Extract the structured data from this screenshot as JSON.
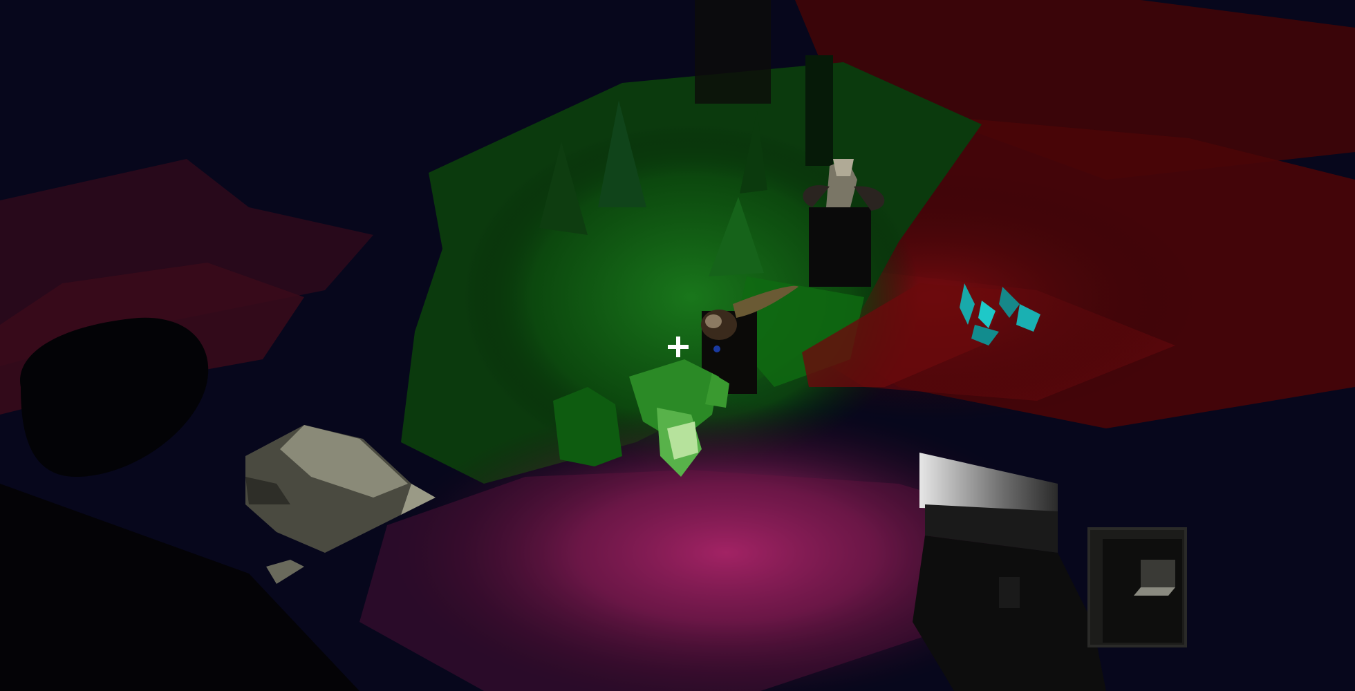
{
  "scene": {
    "colors": {
      "sky": "#06061a",
      "red_terrain": "#5a0a0e",
      "green_terrain": "#0f5a12",
      "magenta_light": "#c02a78",
      "crystal": "#1ec8c8",
      "weapon": "#141414"
    }
  },
  "hud": {
    "crosshair_icon": "crosshair-icon"
  }
}
